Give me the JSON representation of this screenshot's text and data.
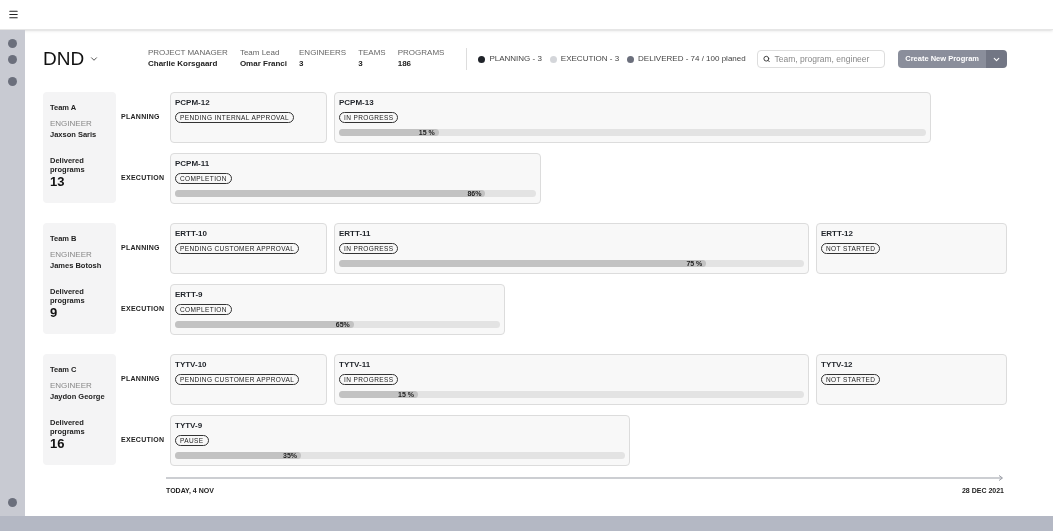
{
  "project": {
    "name": "DND"
  },
  "stats": [
    {
      "label": "PROJECT MANAGER",
      "value": "Charlie Korsgaard"
    },
    {
      "label": "Team Lead",
      "value": "Omar Franci"
    },
    {
      "label": "ENGINEERS",
      "value": "3"
    },
    {
      "label": "TEAMS",
      "value": "3"
    },
    {
      "label": "PROGRAMS",
      "value": "186"
    }
  ],
  "legend": [
    {
      "label": "PLANNING - 3",
      "color": "#1f2329"
    },
    {
      "label": "EXECUTION - 3",
      "color": "#d4d6da"
    },
    {
      "label": "DELIVERED - 74 / 100 planed",
      "color": "#6b6f7c"
    }
  ],
  "search": {
    "placeholder": "Team, program, engineer"
  },
  "create_button": "Create New Program",
  "teams": [
    {
      "name": "Team A",
      "engineer_label": "ENGINEER",
      "engineer": "Jaxson Saris",
      "delivered_label": "Delivered programs",
      "delivered": "13",
      "lanes": [
        {
          "label": "PLANNING",
          "programs": [
            {
              "id": "PCPM-12",
              "status": "PENDING INTERNAL APPROVAL"
            },
            {
              "id": "PCPM-13",
              "status": "IN PROGRESS",
              "level": 0.17,
              "reading": "15 %"
            }
          ]
        },
        {
          "label": "EXECUTION",
          "programs": [
            {
              "id": "PCPM-11",
              "status": "COMPLETION",
              "level": 0.86,
              "reading": "86%"
            }
          ]
        }
      ]
    },
    {
      "name": "Team B",
      "engineer_label": "ENGINEER",
      "engineer": "James Botosh",
      "delivered_label": "Delivered programs",
      "delivered": "9",
      "lanes": [
        {
          "label": "PLANNING",
          "programs": [
            {
              "id": "ERTT-10",
              "status": "PENDING CUSTOMER APPROVAL"
            },
            {
              "id": "ERTT-11",
              "status": "IN PROGRESS",
              "level": 0.79,
              "reading": "75 %"
            },
            {
              "id": "ERTT-12",
              "status": "NOT STARTED"
            }
          ]
        },
        {
          "label": "EXECUTION",
          "programs": [
            {
              "id": "ERTT-9",
              "status": "COMPLETION",
              "level": 0.55,
              "reading": "65%"
            }
          ]
        }
      ]
    },
    {
      "name": "Team C",
      "engineer_label": "ENGINEER",
      "engineer": "Jaydon George",
      "delivered_label": "Delivered programs",
      "delivered": "16",
      "lanes": [
        {
          "label": "PLANNING",
          "programs": [
            {
              "id": "TYTV-10",
              "status": "PENDING CUSTOMER APPROVAL"
            },
            {
              "id": "TYTV-11",
              "status": "IN PROGRESS",
              "level": 0.17,
              "reading": "15 %"
            },
            {
              "id": "TYTV-12",
              "status": "NOT STARTED"
            }
          ]
        },
        {
          "label": "EXECUTION",
          "programs": [
            {
              "id": "TYTV-9",
              "status": "PAUSE",
              "level": 0.28,
              "reading": "35%"
            }
          ]
        }
      ]
    }
  ],
  "timeline": {
    "start": "TODAY, 4 NOV",
    "end": "28 DEC 2021"
  }
}
